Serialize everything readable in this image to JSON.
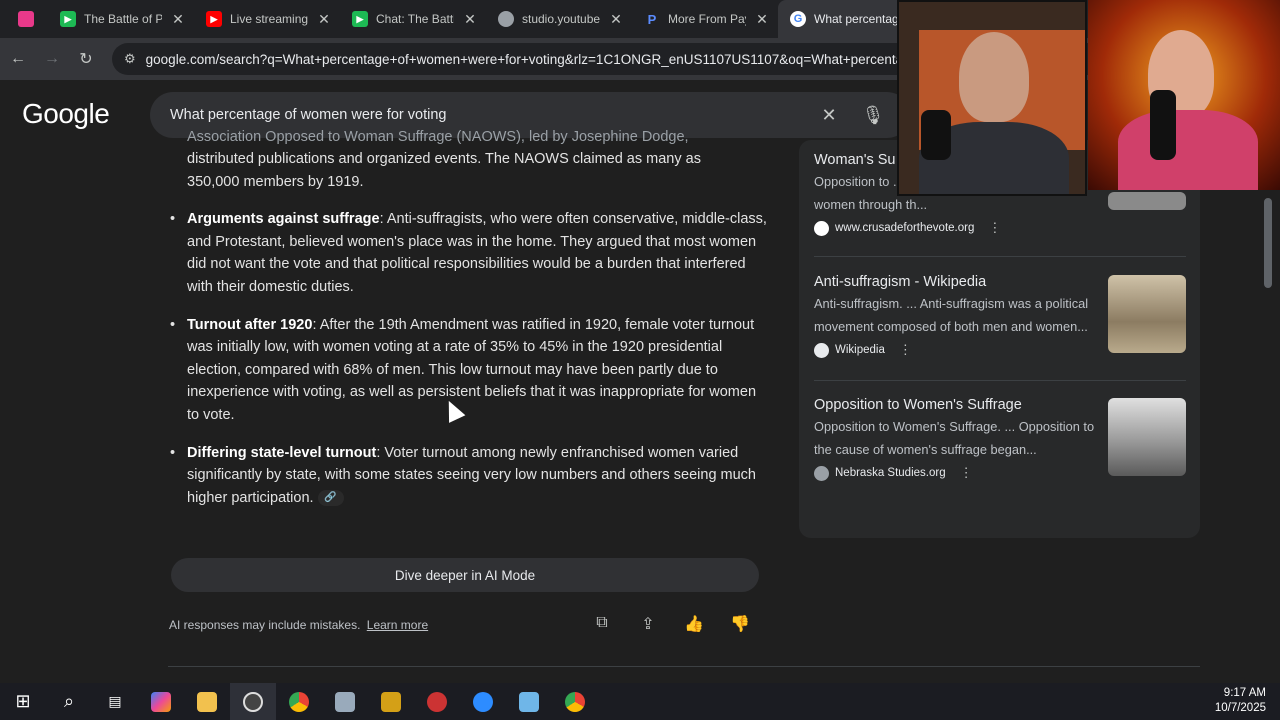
{
  "browser": {
    "tabs": [
      {
        "title": "The Battle of Po",
        "favicon_color": "#1db954"
      },
      {
        "title": "Live streaming",
        "favicon_color": "#ff0000"
      },
      {
        "title": "Chat: The Battle",
        "favicon_color": "#1db954"
      },
      {
        "title": "studio.youtube.",
        "favicon_color": "#9aa0a6"
      },
      {
        "title": "More From Payl",
        "favicon_color": "#3b5bdb"
      },
      {
        "title": "What percentag",
        "favicon_color": "#4285f4"
      }
    ],
    "url": "google.com/search?q=What+percentage+of+women+were+for+voting&rlz=1C1ONGR_enUS1107US1107&oq=What+percentag"
  },
  "search": {
    "logo": "Google",
    "query": "What percentage of women were for voting"
  },
  "ai_overview": {
    "intro_lines": [
      "Association Opposed to Woman Suffrage (NAOWS), led by Josephine Dodge,",
      "distributed publications and organized events. The NAOWS claimed as many as",
      "350,000 members by 1919."
    ],
    "bullets": [
      {
        "bold": "Arguments against suffrage",
        "text": ": Anti-suffragists, who were often conservative, middle-class, and Protestant, believed women's place was in the home. They argued that most women did not want the vote and that political responsibilities would be a burden that interfered with their domestic duties."
      },
      {
        "bold": "Turnout after 1920",
        "text": ": After the 19th Amendment was ratified in 1920, female voter turnout was initially low, with women voting at a rate of 35% to 45% in the 1920 presidential election, compared with 68% of men. This low turnout may have been partly due to inexperience with voting, as well as persistent beliefs that it was inappropriate for women to vote."
      },
      {
        "bold": "Differing state-level turnout",
        "text": ": Voter turnout among newly enfranchised women varied significantly by state, with some states seeing very low numbers and others seeing much higher participation."
      }
    ],
    "dive_button": "Dive deeper in AI Mode",
    "disclaimer": "AI responses may include mistakes.",
    "learn_more": "Learn more"
  },
  "sources": [
    {
      "title": "Woman's Su",
      "desc": "Opposition to ... dominated among men and women through th...",
      "source": "www.crusadeforthevote.org"
    },
    {
      "title": "Anti-suffragism - Wikipedia",
      "desc": "Anti-suffragism. ... Anti-suffragism was a political movement composed of both men and women...",
      "source": "Wikipedia"
    },
    {
      "title": "Opposition to Women's Suffrage",
      "desc": "Opposition to Women's Suffrage. ... Opposition to the cause of women's suffrage began...",
      "source": "Nebraska Studies.org"
    }
  ],
  "taskbar": {
    "time": "9:17 AM",
    "date": "10/7/2025"
  }
}
